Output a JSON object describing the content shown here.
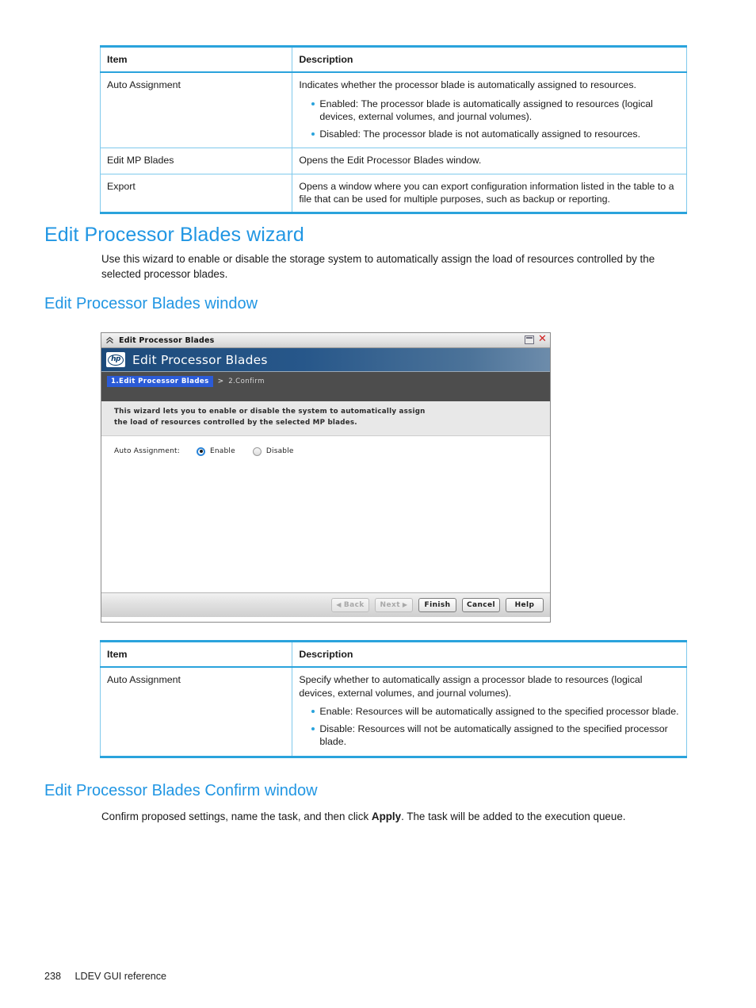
{
  "table_1": {
    "headers": [
      "Item",
      "Description"
    ],
    "rows": [
      {
        "item": "Auto Assignment",
        "desc_intro": "Indicates whether the processor blade is automatically assigned to resources.",
        "bullets": [
          "Enabled: The processor blade is automatically assigned to resources (logical devices, external volumes, and journal volumes).",
          "Disabled: The processor blade is not automatically assigned to resources."
        ]
      },
      {
        "item": "Edit MP Blades",
        "desc_intro": "Opens the Edit Processor Blades window.",
        "bullets": []
      },
      {
        "item": "Export",
        "desc_intro": "Opens a window where you can export configuration information listed in the table to a file that can be used for multiple purposes, such as backup or reporting.",
        "bullets": []
      }
    ]
  },
  "section_wizard": {
    "heading": "Edit Processor Blades wizard",
    "paragraph": "Use this wizard to enable or disable the storage system to automatically assign the load of resources controlled by the selected processor blades."
  },
  "section_window": {
    "heading": "Edit Processor Blades window"
  },
  "app_window": {
    "titlebar": {
      "title": "Edit Processor Blades",
      "collapse_icon": "chevron-double-up-icon",
      "maximize_icon": "maximize-icon",
      "close_icon": "close-icon"
    },
    "banner": {
      "logo_text": "hp",
      "title": "Edit Processor Blades"
    },
    "breadcrumb": {
      "active": "1.Edit Processor Blades",
      "separator": ">",
      "next": "2.Confirm"
    },
    "instructions_line1": "This wizard lets you to enable or disable the system to automatically assign",
    "instructions_line2": "the load of resources controlled by the selected MP blades.",
    "field": {
      "label": "Auto Assignment:",
      "options": [
        {
          "label": "Enable",
          "selected": true
        },
        {
          "label": "Disable",
          "selected": false
        }
      ]
    },
    "buttons": [
      {
        "label": "Back",
        "disabled": true,
        "arrow": "left"
      },
      {
        "label": "Next",
        "disabled": true,
        "arrow": "right"
      },
      {
        "label": "Finish",
        "disabled": false,
        "arrow": ""
      },
      {
        "label": "Cancel",
        "disabled": false,
        "arrow": ""
      },
      {
        "label": "Help",
        "disabled": false,
        "arrow": ""
      }
    ]
  },
  "table_2": {
    "headers": [
      "Item",
      "Description"
    ],
    "rows": [
      {
        "item": "Auto Assignment",
        "desc_intro": "Specify whether to automatically assign a processor blade to resources (logical devices, external volumes, and journal volumes).",
        "bullets": [
          "Enable: Resources will be automatically assigned to the specified processor blade.",
          "Disable: Resources will not be automatically assigned to the specified processor blade."
        ]
      }
    ]
  },
  "section_confirm": {
    "heading": "Edit Processor Blades Confirm window",
    "paragraph_before": "Confirm proposed settings, name the task, and then click ",
    "paragraph_bold": "Apply",
    "paragraph_after": ". The task will be added to the execution queue."
  },
  "footer": {
    "page_number": "238",
    "chapter": "LDEV GUI reference"
  },
  "colors": {
    "accent_blue": "#2196e3",
    "table_border": "#2aa3dc",
    "table_inner": "#7fc9ec",
    "banner_dark": "#1d4a7a",
    "crumb_bg": "#4d4d4d",
    "crumb_active": "#2b5bd7",
    "close_red": "#d12020"
  }
}
